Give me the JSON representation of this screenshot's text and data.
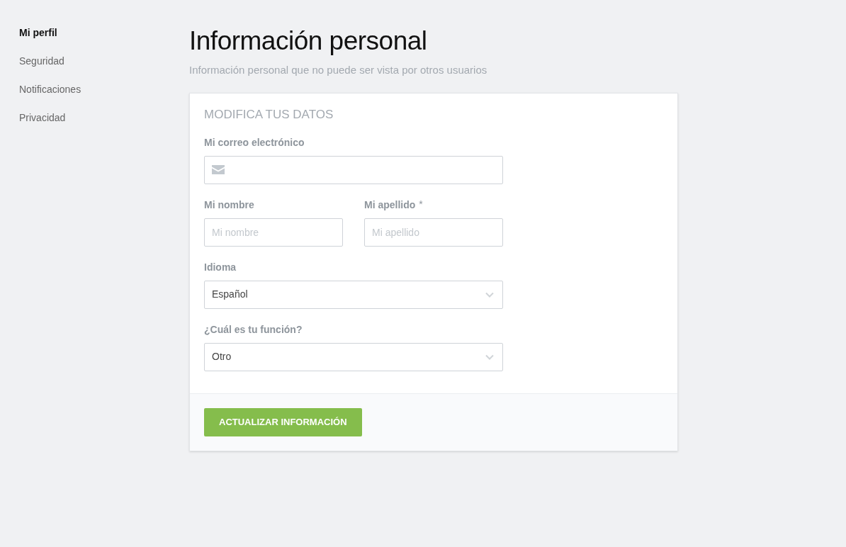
{
  "sidebar": {
    "items": [
      {
        "label": "Mi perfil",
        "selected": true
      },
      {
        "label": "Seguridad",
        "selected": false
      },
      {
        "label": "Notificaciones",
        "selected": false
      },
      {
        "label": "Privacidad",
        "selected": false
      }
    ]
  },
  "header": {
    "title": "Información personal",
    "subtitle": "Información personal que no puede ser vista por otros usuarios"
  },
  "form": {
    "heading": "MODIFICA TUS DATOS",
    "rows": [
      {
        "fields": [
          {
            "kind": "email",
            "label": "Mi correo electrónico"
          }
        ]
      },
      {
        "fields": [
          {
            "kind": "text",
            "label": "Mi nombre",
            "placeholder": "Mi nombre"
          },
          {
            "kind": "text",
            "label": "Mi apellido",
            "required_mark": "*",
            "placeholder": "Mi apellido"
          }
        ]
      },
      {
        "fields": [
          {
            "kind": "select",
            "label": "Idioma",
            "value": "Español"
          }
        ]
      },
      {
        "fields": [
          {
            "kind": "select",
            "label": "¿Cuál es tu función?",
            "value": "Otro"
          }
        ]
      }
    ],
    "submit": "ACTUALIZAR INFORMACIÓN"
  }
}
